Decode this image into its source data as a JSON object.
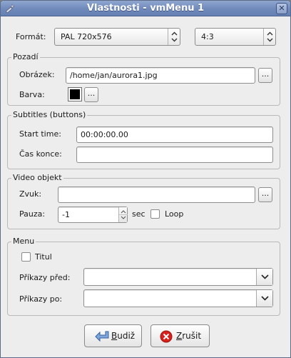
{
  "window": {
    "title": "Vlastnosti - vmMenu 1",
    "close_glyph": "✕"
  },
  "format": {
    "label": "Formát:",
    "video_value": "PAL 720x576",
    "aspect_value": "4:3"
  },
  "background": {
    "legend": "Pozadí",
    "image_label": "Obrázek:",
    "image_value": "/home/jan/aurora1.jpg",
    "browse_label": "...",
    "color_label": "Barva:",
    "color_value": "#000000",
    "color_button_label": "..."
  },
  "subtitles": {
    "legend": "Subtitles (buttons)",
    "start_label": "Start time:",
    "start_value": "00:00:00.00",
    "end_label": "Čas konce:",
    "end_value": ""
  },
  "video_object": {
    "legend": "Video objekt",
    "sound_label": "Zvuk:",
    "sound_value": "",
    "browse_label": "...",
    "pause_label": "Pauza:",
    "pause_value": "-1",
    "pause_unit": "sec",
    "loop_label": "Loop",
    "loop_checked": false
  },
  "menu": {
    "legend": "Menu",
    "title_label": "Titul",
    "title_checked": false,
    "pre_label": "Příkazy před:",
    "pre_value": "",
    "post_label": "Příkazy po:",
    "post_value": ""
  },
  "buttons": {
    "ok_prefix": "",
    "ok_mnemonic": "B",
    "ok_rest": "udiž",
    "cancel_mnemonic": "Z",
    "cancel_rest": "rušit"
  },
  "icons": {
    "app": "wand-icon",
    "ok": "enter-arrow-icon",
    "cancel": "cancel-circle-icon"
  },
  "colors": {
    "titlebar": "#6f89bb",
    "cancel_icon": "#d8211b",
    "ok_icon": "#5b8cd0"
  }
}
